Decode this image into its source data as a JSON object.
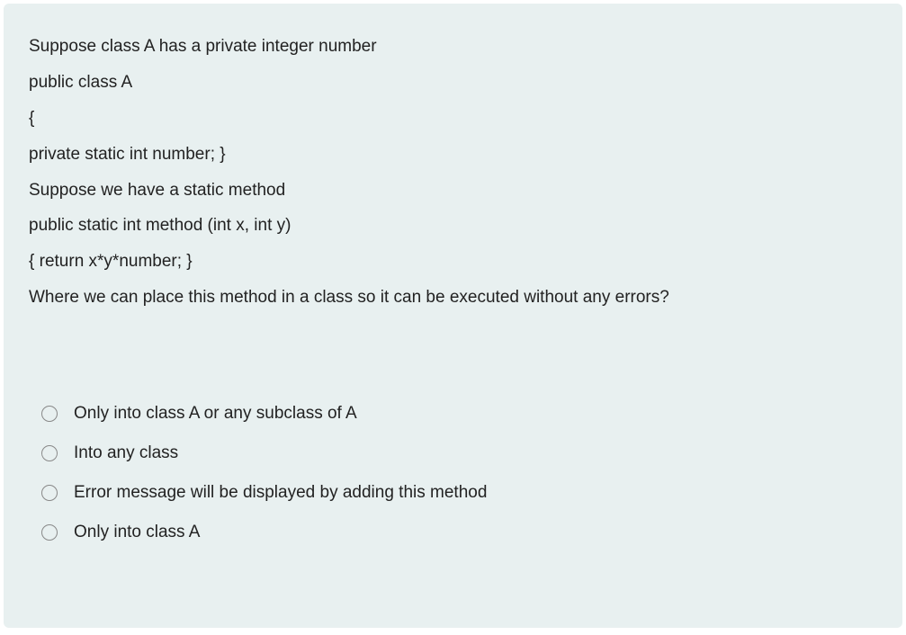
{
  "question": {
    "lines": [
      "Suppose class A has a private integer number",
      "public class A",
      "{",
      "private static  int  number; }",
      "Suppose we have a static method",
      "public static int method (int x, int y)",
      "{   return x*y*number; }",
      "Where we can place this method in a class so it can be executed without any errors?"
    ]
  },
  "options": [
    {
      "label": "Only into class A or any subclass of A"
    },
    {
      "label": "Into any class"
    },
    {
      "label": "Error message will be displayed by adding this method"
    },
    {
      "label": "Only into class A"
    }
  ]
}
